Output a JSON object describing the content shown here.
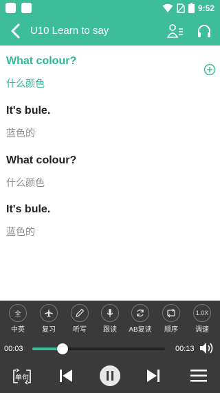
{
  "status_bar": {
    "time": "9:52"
  },
  "header": {
    "title": "U10 Learn to say"
  },
  "sentences": [
    {
      "en": "What colour?",
      "zh": "什么颜色",
      "active": true
    },
    {
      "en": "It's bule.",
      "zh": "蓝色的",
      "active": false
    },
    {
      "en": "What colour?",
      "zh": "什么颜色",
      "active": false
    },
    {
      "en": "It's bule.",
      "zh": "蓝色的",
      "active": false
    }
  ],
  "toolbar": {
    "items": [
      {
        "label": "中英",
        "glyph": "全",
        "icon": "language-icon"
      },
      {
        "label": "复习",
        "glyph": "",
        "icon": "plane-icon"
      },
      {
        "label": "听写",
        "glyph": "",
        "icon": "pencil-icon"
      },
      {
        "label": "跟读",
        "glyph": "",
        "icon": "microphone-icon"
      },
      {
        "label": "AB复读",
        "glyph": "",
        "icon": "ab-repeat-icon"
      },
      {
        "label": "顺序",
        "glyph": "",
        "icon": "order-icon"
      },
      {
        "label": "调速",
        "glyph": "1.0X",
        "icon": "speed-icon"
      }
    ]
  },
  "player": {
    "current_time": "00:03",
    "total_time": "00:13",
    "progress": 0.23,
    "mode_label": "单句"
  },
  "colors": {
    "accent": "#3dbd9a",
    "bar": "#3a3a3a"
  }
}
